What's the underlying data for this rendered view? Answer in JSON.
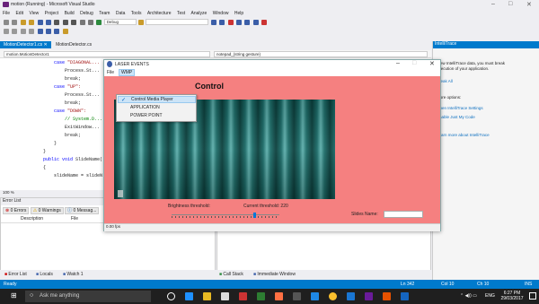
{
  "vs": {
    "title": "motion (Running) - Microsoft Visual Studio",
    "menu": [
      "File",
      "Edit",
      "View",
      "Project",
      "Build",
      "Debug",
      "Team",
      "Data",
      "Tools",
      "Architecture",
      "Test",
      "Analyze",
      "Window",
      "Help"
    ],
    "toolbar_debug_label": "Debug",
    "doc_tabs": [
      "MotionDetector1.cs",
      "MotionDetector.cs"
    ],
    "nav_left": "motion.MotionDetector1",
    "nav_right": "notepad_(string gesture)",
    "code_lines": [
      {
        "indent": "        ",
        "kw": "case",
        "text": " \"DIAGONAL...",
        "cls": ""
      },
      {
        "indent": "            ",
        "kw": "",
        "text": "Process.St...",
        "cls": ""
      },
      {
        "indent": "            ",
        "kw": "",
        "text": "break;",
        "cls": ""
      },
      {
        "indent": "        ",
        "kw": "case",
        "text": " \"UP\":",
        "cls": ""
      },
      {
        "indent": "            ",
        "kw": "",
        "text": "Process.St...",
        "cls": ""
      },
      {
        "indent": "            ",
        "kw": "",
        "text": "break;",
        "cls": ""
      },
      {
        "indent": "        ",
        "kw": "case",
        "text": " \"DOWN\":",
        "cls": ""
      },
      {
        "indent": "            ",
        "kw": "",
        "text": "// System.D...",
        "cls": "cm"
      },
      {
        "indent": "            ",
        "kw": "",
        "text": "ExitWindow...",
        "cls": ""
      },
      {
        "indent": "            ",
        "kw": "",
        "text": "break;",
        "cls": ""
      },
      {
        "indent": "        ",
        "kw": "",
        "text": "}",
        "cls": ""
      },
      {
        "indent": "    ",
        "kw": "",
        "text": "}",
        "cls": ""
      },
      {
        "indent": "    ",
        "kw": "public void",
        "text": " SlideName(...",
        "cls": ""
      },
      {
        "indent": "    ",
        "kw": "",
        "text": "{",
        "cls": ""
      },
      {
        "indent": "        ",
        "kw": "",
        "text": "slideName = slideN...",
        "cls": ""
      }
    ],
    "zoom": "100 %",
    "error_list": {
      "title": "Error List",
      "errors": "0 Errors",
      "warnings": "0 Warnings",
      "messages": "0 Messag...",
      "col_description": "Description",
      "col_file": "File"
    },
    "bottom_tabs": [
      "Error List",
      "Locals",
      "Watch 1"
    ],
    "bottom_tabs_right": [
      "Call Stack",
      "Immediate Window"
    ],
    "intellitrace": {
      "title": "IntelliTrace",
      "line1": "View IntelliTrace data, you must break",
      "line2": "execution of your application.",
      "break_all": "Break All",
      "options_title": "More options:",
      "opt1": "Open IntelliTrace Settings",
      "opt2": "Enable Just My Code",
      "opt3": "Learn more about IntelliTrace"
    },
    "status": {
      "left": "Ready",
      "ln": "Ln 342",
      "col": "Col 10",
      "ch": "Ch 10",
      "ins": "INS"
    }
  },
  "laser": {
    "title": "LASER EVENTS",
    "menu_file": "File",
    "menu_wmp": "WMP",
    "heading_suffix": "Control",
    "menu_items": [
      "Control Media Player",
      "APPLICATION",
      "POWER POINT"
    ],
    "brightness_label": "Brightness threshold:",
    "current_threshold": "Current threshold: 220",
    "slides_name_label": "Slides Name:",
    "status_fps": "0.00 fps",
    "client_color": "#f58080"
  },
  "taskbar": {
    "search_placeholder": "Ask me anything",
    "lang": "ENG",
    "time": "6:27 PM",
    "date": "29/03/2017"
  }
}
